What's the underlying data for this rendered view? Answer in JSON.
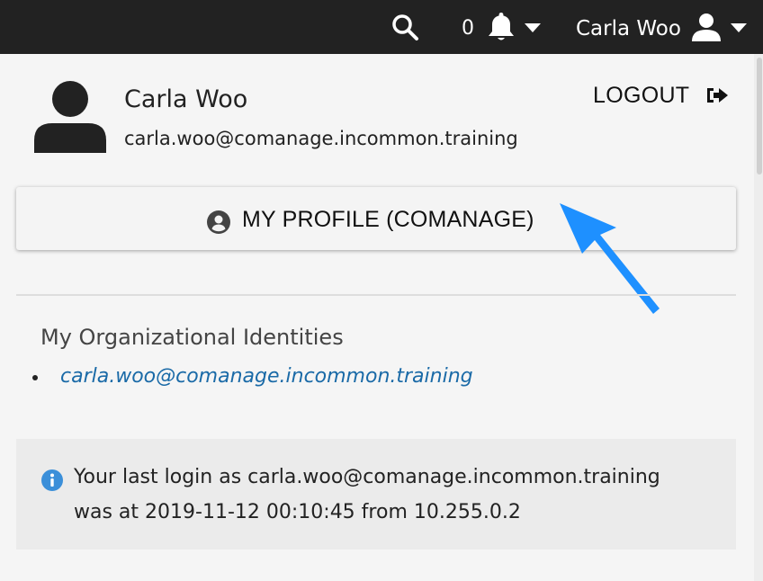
{
  "topbar": {
    "notification_count": "0",
    "user_name": "Carla Woo",
    "icons": [
      "search-icon",
      "bell-icon",
      "chevron-down-icon",
      "user-icon",
      "chevron-down-icon"
    ]
  },
  "profile": {
    "name": "Carla Woo",
    "email": "carla.woo@comanage.incommon.training",
    "logout_label": "LOGOUT",
    "my_profile_label": "MY PROFILE (COMANAGE)"
  },
  "org_identities": {
    "heading": "My Organizational Identities",
    "items": [
      "carla.woo@comanage.incommon.training"
    ]
  },
  "last_login": {
    "line1": "Your last login as carla.woo@comanage.incommon.training",
    "line2": "was at 2019-11-12 00:10:45 from 10.255.0.2"
  },
  "colors": {
    "topbar_bg": "#222222",
    "link": "#1a6aa7",
    "annotation_arrow": "#1e90ff",
    "info_icon": "#3b8fd9"
  }
}
